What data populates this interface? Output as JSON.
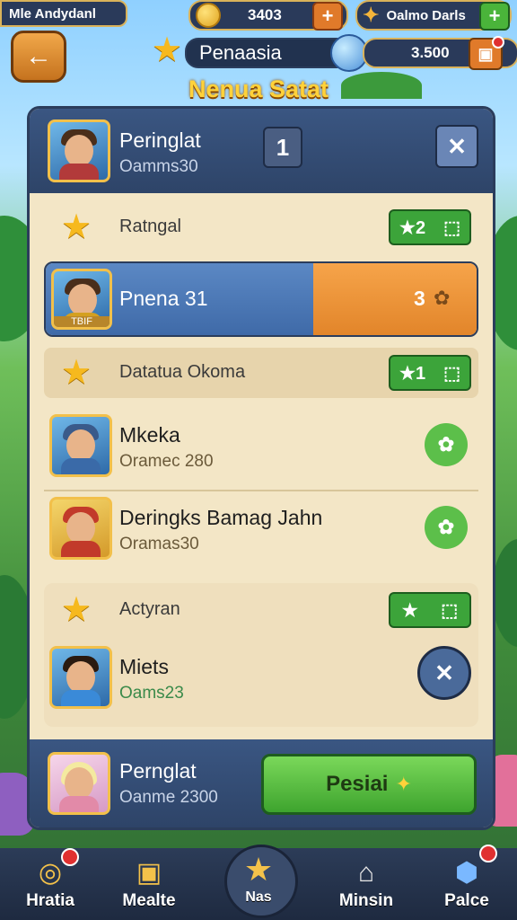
{
  "top": {
    "player_name": "Mle Andydanl",
    "coins": "3403",
    "shop_label": "Oalmo Darls",
    "header_title": "Penaasia",
    "gems": "3.500",
    "screen_title": "Nenua Satat"
  },
  "header": {
    "name": "Peringlat",
    "sub": "Oamms30",
    "rank_icon": "1"
  },
  "sections": [
    {
      "title": "Ratngal",
      "badge_left": "2",
      "badge_icon": "box-icon"
    },
    {
      "title": "Datatua Okoma",
      "badge_left": "1",
      "badge_icon": "box-icon"
    },
    {
      "title": "Actyran",
      "badge_left": "",
      "badge_icon": "box-icon"
    }
  ],
  "highlight": {
    "name": "Pnena 31",
    "value": "3",
    "avatar_tag": "TBIF"
  },
  "rows": [
    {
      "name": "Mkeka",
      "sub": "Oramec 280"
    },
    {
      "name": "Deringks Bamag Jahn",
      "sub": "Oramas30"
    },
    {
      "name": "Miets",
      "sub": "Oams23"
    }
  ],
  "footer": {
    "name": "Pernglat",
    "sub": "Oanme 2300",
    "button": "Pesiai"
  },
  "nav": [
    {
      "label": "Hratia"
    },
    {
      "label": "Mealte"
    },
    {
      "label": "Nas"
    },
    {
      "label": "Minsin"
    },
    {
      "label": "Palce"
    }
  ],
  "colors": {
    "accent": "#f3943a",
    "green": "#3ca43a",
    "panel": "#f3e6c6",
    "header": "#2e4468"
  }
}
